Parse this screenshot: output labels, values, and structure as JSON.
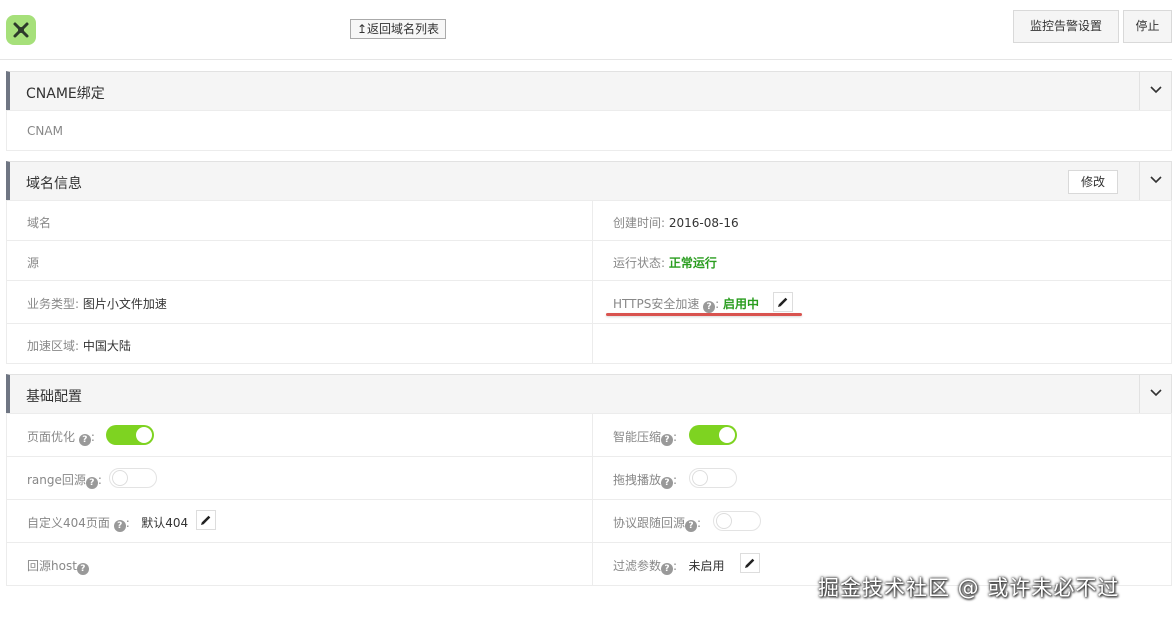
{
  "topbar": {
    "back_label": "↥返回域名列表",
    "monitor_label": "监控告警设置",
    "stop_label": "停止"
  },
  "cname": {
    "title": "CNAME绑定",
    "row_label": "CNAM"
  },
  "domain_info": {
    "title": "域名信息",
    "edit_label": "修改",
    "domain_label": "域名",
    "created_label": "创建时间: ",
    "created_value": "2016-08-16",
    "origin_label": "源",
    "status_label": "运行状态: ",
    "status_value": "正常运行",
    "biz_label": "业务类型: ",
    "biz_value": "图片小文件加速",
    "https_label": "HTTPS安全加速",
    "https_value": "启用中",
    "region_label": "加速区域: ",
    "region_value": "中国大陆"
  },
  "basic_config": {
    "title": "基础配置",
    "page_opt_label": "页面优化",
    "page_opt_on": true,
    "compress_label": "智能压缩",
    "compress_on": true,
    "range_label": "range回源",
    "range_on": false,
    "drag_label": "拖拽播放",
    "drag_on": false,
    "custom404_label": "自定义404页面",
    "custom404_value": "默认404",
    "protocol_label": "协议跟随回源",
    "protocol_on": false,
    "origin_host_label": "回源host",
    "filter_label": "过滤参数",
    "filter_value": "未启用"
  },
  "watermark": "掘金技术社区 @ 或许未必不过",
  "colors": {
    "accent_green": "#7ed321",
    "status_green": "#2a9d1f",
    "highlight_red": "#d9534f",
    "section_bar": "#6f7683"
  }
}
